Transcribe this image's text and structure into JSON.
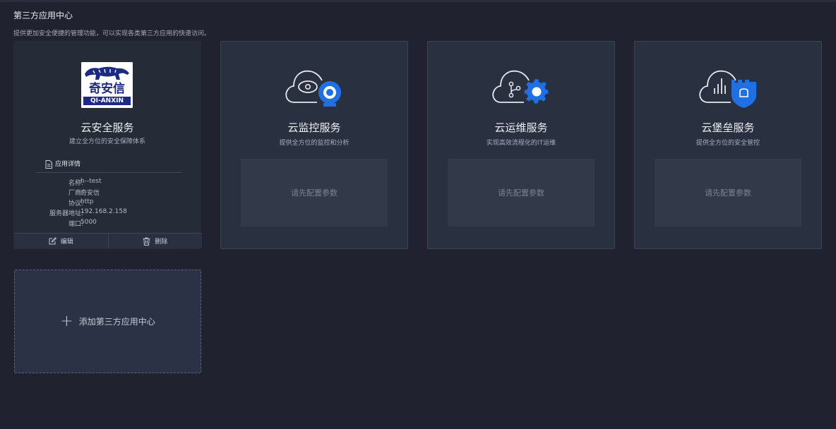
{
  "header": {
    "title": "第三方应用中心",
    "description": "提供更加安全便捷的管理功能，可以实现各类第三方应用的快速访问。"
  },
  "cards": [
    {
      "title": "云安全服务",
      "subtitle": "建立全方位的安全保障体系",
      "logo": {
        "cn": "奇安信",
        "en": "QI-ANXIN"
      },
      "detail_title": "应用详情",
      "details": [
        {
          "key": "名称:",
          "value": "h--test"
        },
        {
          "key": "厂商:",
          "value": "奇安信"
        },
        {
          "key": "协议:",
          "value": "http"
        },
        {
          "key": "服务器地址:",
          "value": "192.168.2.158"
        },
        {
          "key": "端口:",
          "value": "5000"
        }
      ],
      "actions": {
        "edit": "编辑",
        "delete": "删除"
      }
    },
    {
      "title": "云监控服务",
      "subtitle": "提供全方位的监控和分析",
      "placeholder": "请先配置参数",
      "icon": "cloud-camera-icon"
    },
    {
      "title": "云运维服务",
      "subtitle": "实现高效流程化的IT运维",
      "placeholder": "请先配置参数",
      "icon": "cloud-gear-icon"
    },
    {
      "title": "云堡垒服务",
      "subtitle": "提供全方位的安全管控",
      "placeholder": "请先配置参数",
      "icon": "cloud-shield-icon"
    }
  ],
  "add_card": {
    "label": "添加第三方应用中心"
  },
  "colors": {
    "background": "#20232f",
    "card": "#29303f",
    "accent": "#1f6fe5"
  }
}
